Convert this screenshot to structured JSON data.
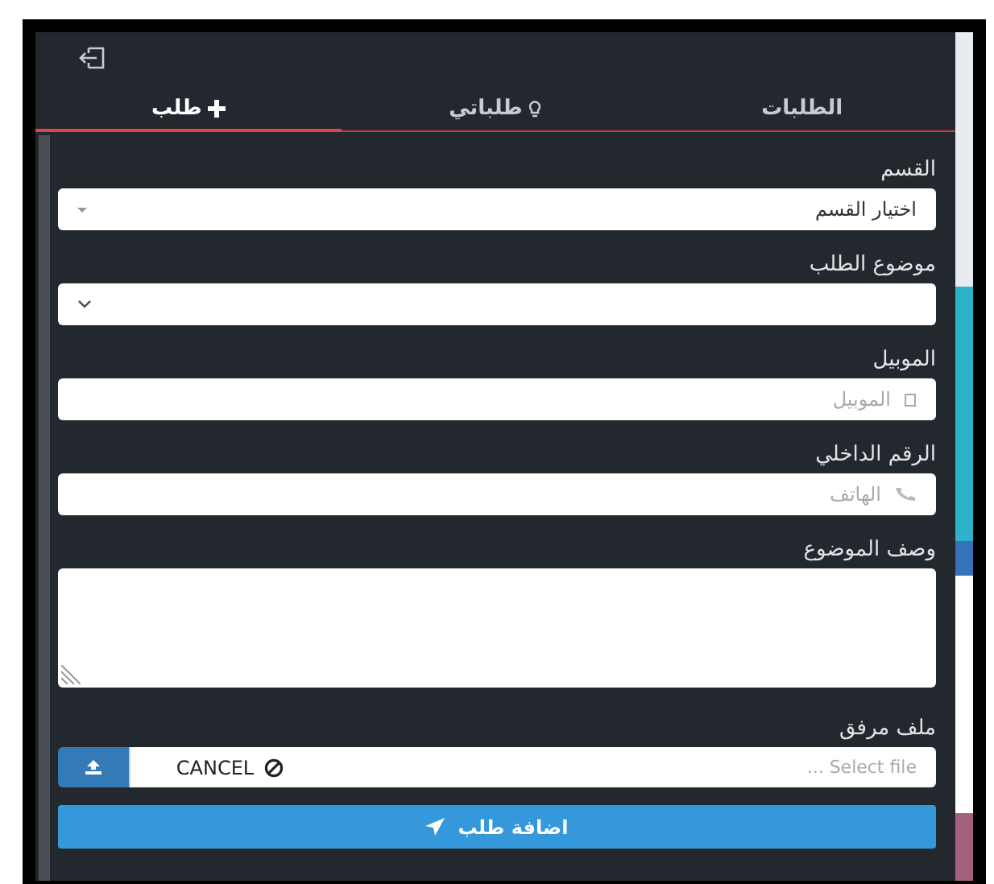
{
  "tabs": [
    {
      "label": "الطلبات",
      "selected": false
    },
    {
      "label": "طلباتي",
      "selected": false
    },
    {
      "label": "طلب",
      "selected": true
    }
  ],
  "fields": [
    {
      "kind": "select",
      "label": "القسم",
      "value": "اختيار القسم"
    },
    {
      "kind": "select",
      "label": "موضوع الطلب"
    },
    {
      "kind": "input",
      "label": "الموبيل",
      "placeholder": "الموبيل"
    },
    {
      "kind": "input",
      "label": "الرقم الداخلي",
      "placeholder": "الهاتف"
    },
    {
      "kind": "textarea",
      "label": "وصف الموضوع"
    },
    {
      "kind": "file",
      "label": "ملف مرفق",
      "placeholder": "... Select file",
      "cancel": "CANCEL"
    }
  ],
  "submit": "اضافة طلب"
}
